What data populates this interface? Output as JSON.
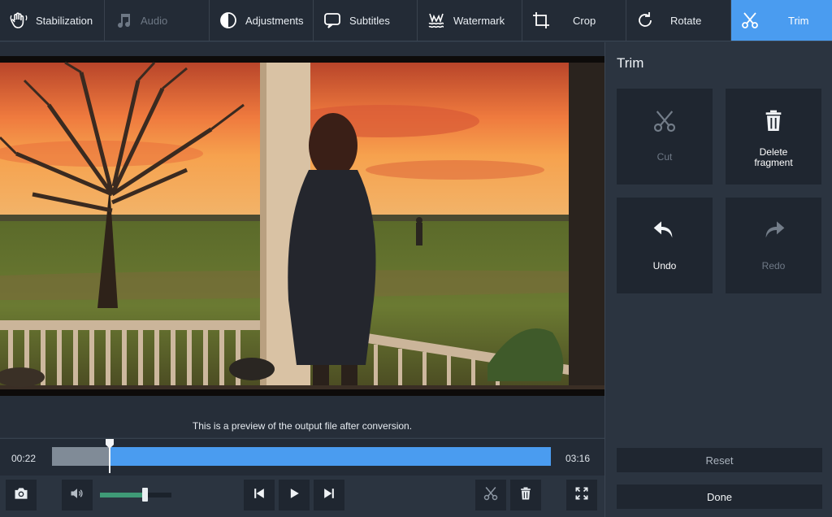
{
  "toolbar": {
    "items": [
      {
        "label": "Stabilization",
        "icon": "hand-icon",
        "state": "normal"
      },
      {
        "label": "Audio",
        "icon": "music-note-icon",
        "state": "disabled"
      },
      {
        "label": "Adjustments",
        "icon": "contrast-icon",
        "state": "normal"
      },
      {
        "label": "Subtitles",
        "icon": "speech-bubble-icon",
        "state": "normal"
      },
      {
        "label": "Watermark",
        "icon": "watermark-icon",
        "state": "normal"
      },
      {
        "label": "Crop",
        "icon": "crop-icon",
        "state": "normal"
      },
      {
        "label": "Rotate",
        "icon": "rotate-icon",
        "state": "normal"
      },
      {
        "label": "Trim",
        "icon": "scissors-icon",
        "state": "active"
      }
    ],
    "active_color": "#4a9cf0"
  },
  "preview": {
    "note": "This is a preview of the output file after conversion."
  },
  "timeline": {
    "start_time": "00:22",
    "end_time": "03:16",
    "progress_fraction": 0.116,
    "track_color": "#4a9cf0"
  },
  "controls": {
    "volume_level": 0.62,
    "buttons": [
      "camera-icon",
      "speaker-icon",
      "skip-back-icon",
      "play-icon",
      "skip-forward-icon",
      "scissors-icon",
      "trash-icon",
      "fullscreen-icon"
    ]
  },
  "panel": {
    "title": "Trim",
    "cut_label": "Cut",
    "delete_label": "Delete\nfragment",
    "undo_label": "Undo",
    "redo_label": "Redo",
    "reset_label": "Reset",
    "done_label": "Done"
  }
}
